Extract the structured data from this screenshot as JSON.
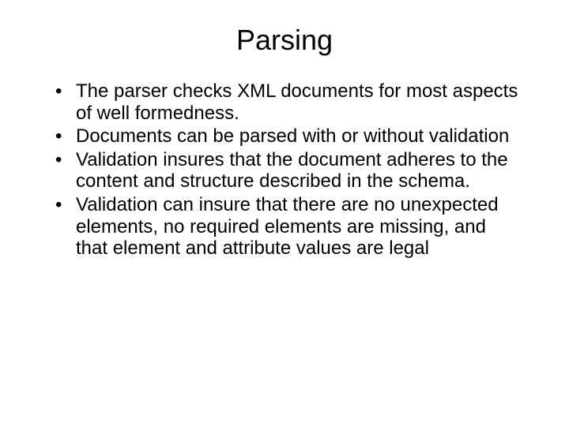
{
  "slide": {
    "title": "Parsing",
    "bullets": [
      "The parser checks XML documents for most aspects of well formedness.",
      "Documents can be parsed with or without validation",
      "Validation insures that the document adheres to the content and structure described in the schema.",
      "Validation can insure that there are no unexpected elements, no required elements are missing, and that element and attribute values are legal"
    ]
  }
}
